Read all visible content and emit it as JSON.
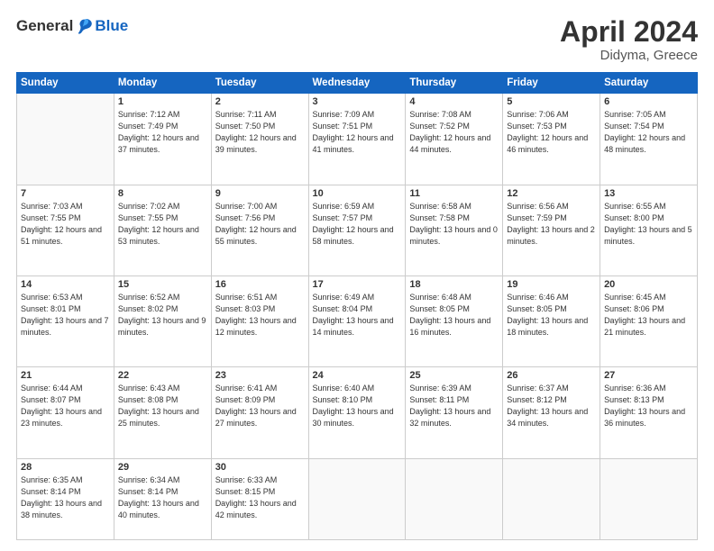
{
  "logo": {
    "general": "General",
    "blue": "Blue"
  },
  "title": {
    "month": "April 2024",
    "location": "Didyma, Greece"
  },
  "weekdays": [
    "Sunday",
    "Monday",
    "Tuesday",
    "Wednesday",
    "Thursday",
    "Friday",
    "Saturday"
  ],
  "weeks": [
    [
      {
        "num": "",
        "empty": true
      },
      {
        "num": "1",
        "sunrise": "7:12 AM",
        "sunset": "7:49 PM",
        "daylight": "12 hours and 37 minutes."
      },
      {
        "num": "2",
        "sunrise": "7:11 AM",
        "sunset": "7:50 PM",
        "daylight": "12 hours and 39 minutes."
      },
      {
        "num": "3",
        "sunrise": "7:09 AM",
        "sunset": "7:51 PM",
        "daylight": "12 hours and 41 minutes."
      },
      {
        "num": "4",
        "sunrise": "7:08 AM",
        "sunset": "7:52 PM",
        "daylight": "12 hours and 44 minutes."
      },
      {
        "num": "5",
        "sunrise": "7:06 AM",
        "sunset": "7:53 PM",
        "daylight": "12 hours and 46 minutes."
      },
      {
        "num": "6",
        "sunrise": "7:05 AM",
        "sunset": "7:54 PM",
        "daylight": "12 hours and 48 minutes."
      }
    ],
    [
      {
        "num": "7",
        "sunrise": "7:03 AM",
        "sunset": "7:55 PM",
        "daylight": "12 hours and 51 minutes."
      },
      {
        "num": "8",
        "sunrise": "7:02 AM",
        "sunset": "7:55 PM",
        "daylight": "12 hours and 53 minutes."
      },
      {
        "num": "9",
        "sunrise": "7:00 AM",
        "sunset": "7:56 PM",
        "daylight": "12 hours and 55 minutes."
      },
      {
        "num": "10",
        "sunrise": "6:59 AM",
        "sunset": "7:57 PM",
        "daylight": "12 hours and 58 minutes."
      },
      {
        "num": "11",
        "sunrise": "6:58 AM",
        "sunset": "7:58 PM",
        "daylight": "13 hours and 0 minutes."
      },
      {
        "num": "12",
        "sunrise": "6:56 AM",
        "sunset": "7:59 PM",
        "daylight": "13 hours and 2 minutes."
      },
      {
        "num": "13",
        "sunrise": "6:55 AM",
        "sunset": "8:00 PM",
        "daylight": "13 hours and 5 minutes."
      }
    ],
    [
      {
        "num": "14",
        "sunrise": "6:53 AM",
        "sunset": "8:01 PM",
        "daylight": "13 hours and 7 minutes."
      },
      {
        "num": "15",
        "sunrise": "6:52 AM",
        "sunset": "8:02 PM",
        "daylight": "13 hours and 9 minutes."
      },
      {
        "num": "16",
        "sunrise": "6:51 AM",
        "sunset": "8:03 PM",
        "daylight": "13 hours and 12 minutes."
      },
      {
        "num": "17",
        "sunrise": "6:49 AM",
        "sunset": "8:04 PM",
        "daylight": "13 hours and 14 minutes."
      },
      {
        "num": "18",
        "sunrise": "6:48 AM",
        "sunset": "8:05 PM",
        "daylight": "13 hours and 16 minutes."
      },
      {
        "num": "19",
        "sunrise": "6:46 AM",
        "sunset": "8:05 PM",
        "daylight": "13 hours and 18 minutes."
      },
      {
        "num": "20",
        "sunrise": "6:45 AM",
        "sunset": "8:06 PM",
        "daylight": "13 hours and 21 minutes."
      }
    ],
    [
      {
        "num": "21",
        "sunrise": "6:44 AM",
        "sunset": "8:07 PM",
        "daylight": "13 hours and 23 minutes."
      },
      {
        "num": "22",
        "sunrise": "6:43 AM",
        "sunset": "8:08 PM",
        "daylight": "13 hours and 25 minutes."
      },
      {
        "num": "23",
        "sunrise": "6:41 AM",
        "sunset": "8:09 PM",
        "daylight": "13 hours and 27 minutes."
      },
      {
        "num": "24",
        "sunrise": "6:40 AM",
        "sunset": "8:10 PM",
        "daylight": "13 hours and 30 minutes."
      },
      {
        "num": "25",
        "sunrise": "6:39 AM",
        "sunset": "8:11 PM",
        "daylight": "13 hours and 32 minutes."
      },
      {
        "num": "26",
        "sunrise": "6:37 AM",
        "sunset": "8:12 PM",
        "daylight": "13 hours and 34 minutes."
      },
      {
        "num": "27",
        "sunrise": "6:36 AM",
        "sunset": "8:13 PM",
        "daylight": "13 hours and 36 minutes."
      }
    ],
    [
      {
        "num": "28",
        "sunrise": "6:35 AM",
        "sunset": "8:14 PM",
        "daylight": "13 hours and 38 minutes."
      },
      {
        "num": "29",
        "sunrise": "6:34 AM",
        "sunset": "8:14 PM",
        "daylight": "13 hours and 40 minutes."
      },
      {
        "num": "30",
        "sunrise": "6:33 AM",
        "sunset": "8:15 PM",
        "daylight": "13 hours and 42 minutes."
      },
      {
        "num": "",
        "empty": true
      },
      {
        "num": "",
        "empty": true
      },
      {
        "num": "",
        "empty": true
      },
      {
        "num": "",
        "empty": true
      }
    ]
  ],
  "labels": {
    "sunrise": "Sunrise:",
    "sunset": "Sunset:",
    "daylight": "Daylight:"
  }
}
